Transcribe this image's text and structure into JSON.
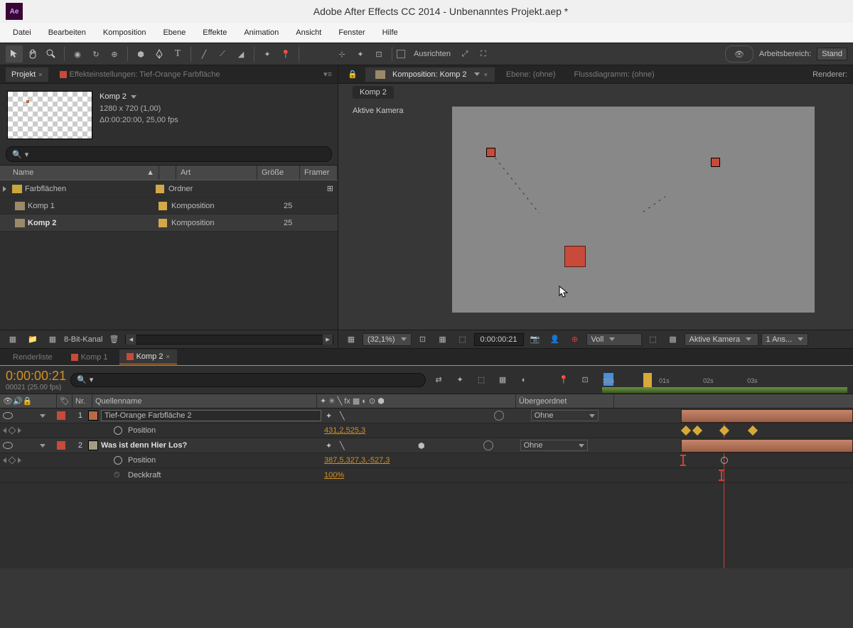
{
  "app": {
    "title": "Adobe After Effects CC 2014 - Unbenanntes Projekt.aep *",
    "badge": "Ae"
  },
  "menu": [
    "Datei",
    "Bearbeiten",
    "Komposition",
    "Ebene",
    "Effekte",
    "Animation",
    "Ansicht",
    "Fenster",
    "Hilfe"
  ],
  "toolbar": {
    "snap_label": "Ausrichten",
    "workspace_label": "Arbeitsbereich:",
    "workspace_value": "Stand"
  },
  "project_panel": {
    "tab_project": "Projekt",
    "tab_fx": "Effekteinstellungen: Tief-Orange Farbfläche",
    "active_item": {
      "name": "Komp 2",
      "dims": "1280 x 720 (1,00)",
      "duration": "Δ0:00:20:00, 25,00 fps"
    },
    "search_placeholder": "",
    "headers": {
      "name": "Name",
      "type": "Art",
      "size": "Größe",
      "frame": "Framer"
    },
    "items": [
      {
        "name": "Farbflächen",
        "type": "Ordner",
        "kind": "folder"
      },
      {
        "name": "Komp 1",
        "type": "Komposition",
        "frame": "25",
        "kind": "comp"
      },
      {
        "name": "Komp 2",
        "type": "Komposition",
        "frame": "25",
        "kind": "comp",
        "selected": true
      }
    ],
    "footer_depth": "8-Bit-Kanal"
  },
  "comp_panel": {
    "tabs": {
      "comp": "Komposition: Komp 2",
      "layer": "Ebene: (ohne)",
      "flow": "Flussdiagramm: (ohne)"
    },
    "renderer_label": "Renderer:",
    "sub_tab": "Komp 2",
    "camera_label": "Aktive Kamera",
    "footer": {
      "zoom": "(32,1%)",
      "timecode": "0:00:00:21",
      "res": "Voll",
      "view": "Aktive Kamera",
      "views": "1 Ans..."
    }
  },
  "timeline": {
    "tabs": {
      "render": "Renderliste",
      "k1": "Komp 1",
      "k2": "Komp 2"
    },
    "time": "0:00:00:21",
    "fps": "00021 (25.00 fps)",
    "ruler": {
      "t0": ":00s",
      "t1": "01s",
      "t2": "02s",
      "t3": "03s"
    },
    "columns": {
      "nr": "Nr.",
      "source": "Quellenname",
      "parent": "Übergeordnet"
    },
    "parent_value": "Ohne",
    "layers": [
      {
        "num": "1",
        "name": "Tief-Orange Farbfläche 2",
        "props": [
          {
            "name": "Position",
            "value": "431,2,525,3",
            "stopwatch": true
          }
        ]
      },
      {
        "num": "2",
        "name": "Was ist denn Hier Los?",
        "props": [
          {
            "name": "Position",
            "value": "387,5,327,3,-527,3",
            "stopwatch": true
          },
          {
            "name": "Deckkraft",
            "value": "100%",
            "stopwatch": false
          }
        ]
      }
    ]
  }
}
